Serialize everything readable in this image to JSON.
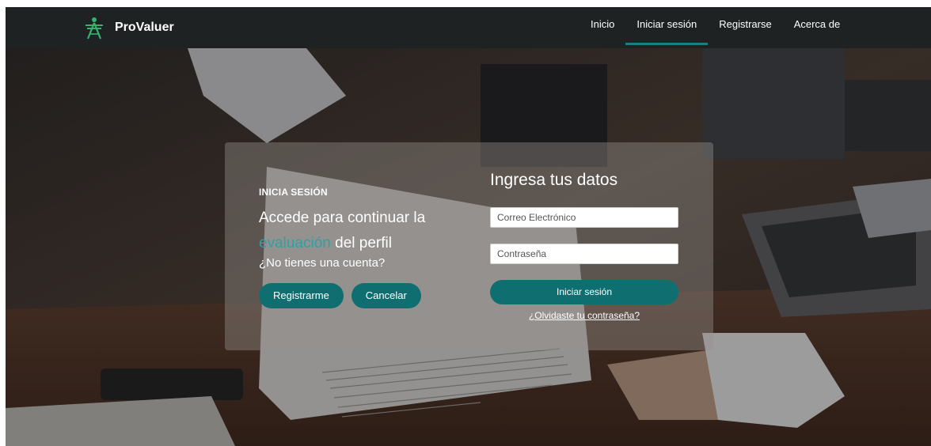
{
  "brand": {
    "name": "ProValuer",
    "logo_icon": "sena-logo-icon"
  },
  "nav": {
    "items": [
      {
        "label": "Inicio",
        "active": false
      },
      {
        "label": "Iniciar sesión",
        "active": true
      },
      {
        "label": "Registrarse",
        "active": false
      },
      {
        "label": "Acerca de",
        "active": false
      }
    ]
  },
  "left_panel": {
    "kicker": "INICIA SESIÓN",
    "headline_part1": "Accede para continuar la",
    "headline_accent": "evaluación",
    "headline_part2": " del perfil",
    "no_account": "¿No tienes una cuenta?",
    "register_label": "Registrarme",
    "cancel_label": "Cancelar"
  },
  "form": {
    "title": "Ingresa tus datos",
    "email_placeholder": "Correo Electrónico",
    "password_placeholder": "Contraseña",
    "submit_label": "Iniciar sesión",
    "forgot_label": "¿Olvidaste tu contraseña?"
  },
  "colors": {
    "navbar": "#1e2223",
    "accent": "#0f6e70",
    "accent_text": "#2aa3a5"
  }
}
